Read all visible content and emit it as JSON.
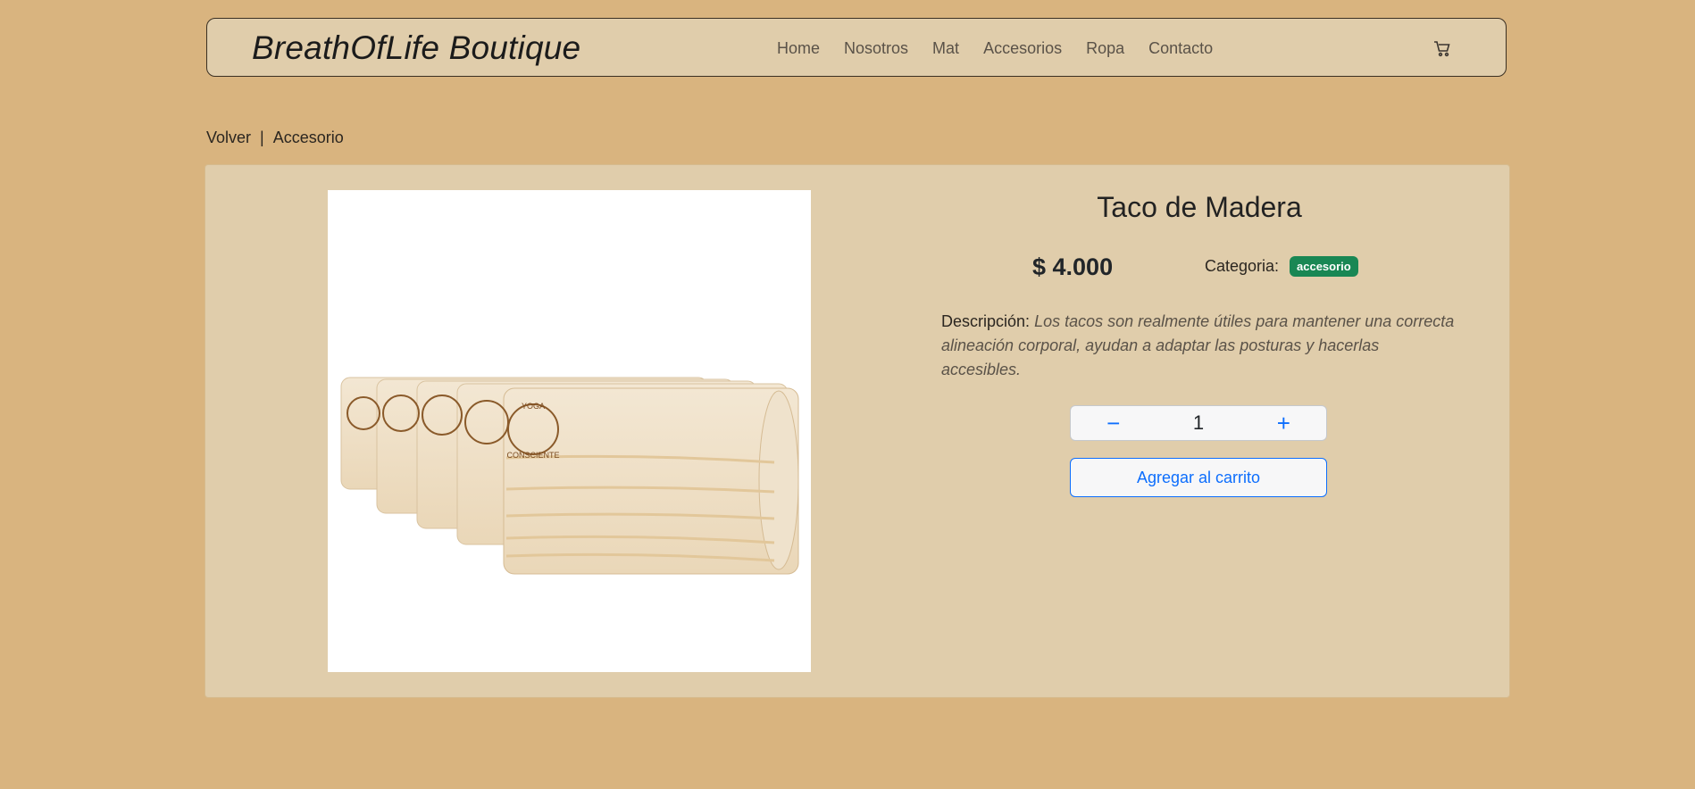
{
  "header": {
    "brand": "BreathOfLife Boutique",
    "nav": [
      "Home",
      "Nosotros",
      "Mat",
      "Accesorios",
      "Ropa",
      "Contacto"
    ],
    "cart_icon": "cart-icon"
  },
  "breadcrumb": {
    "back": "Volver",
    "separator": "|",
    "current": "Accesorio"
  },
  "product": {
    "title": "Taco de Madera",
    "price": "$ 4.000",
    "category_label": "Categoria:",
    "category_badge": "accesorio",
    "description_label": "Descripción:",
    "description": "Los tacos son realmente útiles para mantener una correcta alineación corporal, ayudan a adaptar las posturas y hacerlas accesibles.",
    "image_logo_text": [
      "YOGA",
      "CONSCIENTE"
    ],
    "quantity": "1",
    "minus_label": "−",
    "plus_label": "+",
    "add_to_cart": "Agregar al carrito"
  },
  "colors": {
    "page_bg": "#d9b47f",
    "panel_bg": "#e0cdab",
    "badge": "#198754",
    "primary": "#0d6efd"
  }
}
